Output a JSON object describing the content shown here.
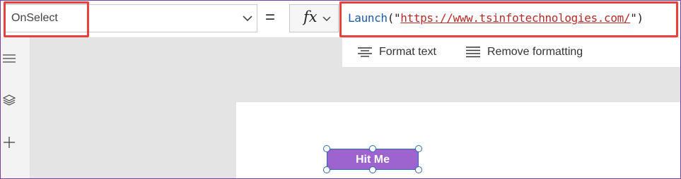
{
  "formula_bar": {
    "property": "OnSelect",
    "equals": "=",
    "fx_label": "fx",
    "formula": {
      "function_name": "Launch",
      "open": "(\"",
      "url": "https://www.tsinfotechnologies.com/",
      "close": "\")"
    }
  },
  "format_toolbar": {
    "format_text": "Format text",
    "remove_formatting": "Remove formatting"
  },
  "left_rail": {
    "icons": [
      "hamburger-menu-icon",
      "layers-icon",
      "plus-icon"
    ]
  },
  "canvas": {
    "button_label": "Hit Me",
    "button_color": "#9d63cf",
    "selection_color": "#2b66b9"
  },
  "annotations": {
    "highlight_color": "#e8413c"
  }
}
